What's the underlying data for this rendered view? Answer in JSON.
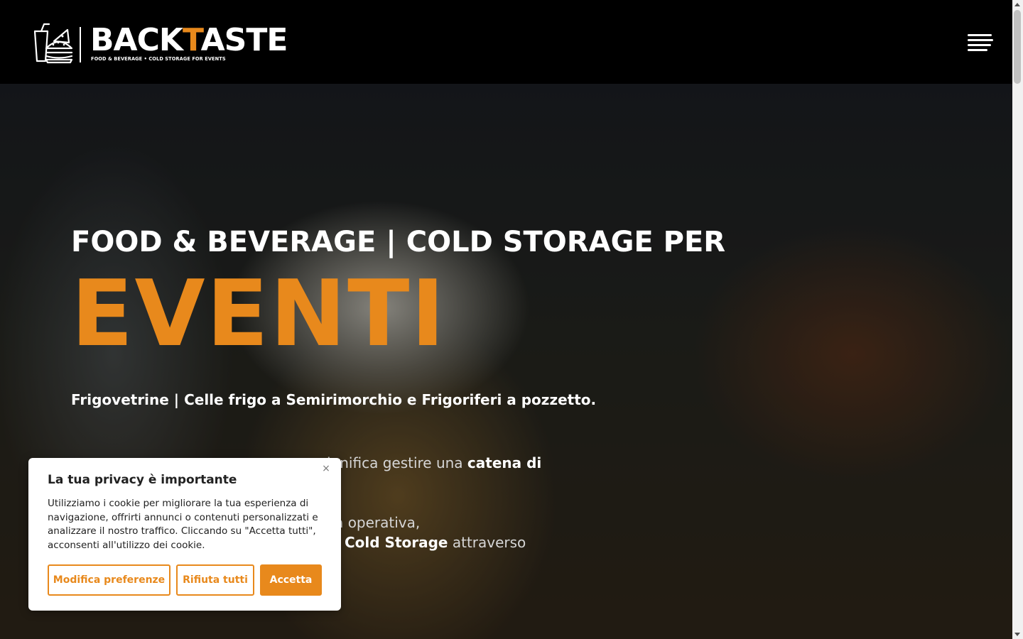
{
  "header": {
    "logo_text_part1": "BACK",
    "logo_text_accent": "T",
    "logo_text_part2": "ASTE",
    "logo_tagline": "FOOD & BEVERAGE • COLD STORAGE FOR EVENTS",
    "accent_color": "#e8891c"
  },
  "hero": {
    "kicker": "FOOD & BEVERAGE | COLD STORAGE PER",
    "title": "EVENTI",
    "subtitle": "Frigovetrine | Celle frigo a Semirimorchio e Frigoriferi a pozzetto.",
    "para1_visible_start": "ignifica gestire una",
    "para1_bold": "catena di",
    "para2_line1": "uità operativa,",
    "para2_bold": "Cold Storage",
    "para2_end": "attraverso"
  },
  "cookie_banner": {
    "title": "La tua privacy è importante",
    "text": "Utilizziamo i cookie per migliorare la tua esperienza di navigazione, offrirti annunci o contenuti personalizzati e analizzare il nostro traffico. Cliccando su \"Accetta tutti\", acconsenti all'utilizzo dei cookie.",
    "close_icon": "×",
    "buttons": {
      "preferences": "Modifica preferenze",
      "reject": "Rifiuta tutti",
      "accept": "Accetta"
    }
  }
}
